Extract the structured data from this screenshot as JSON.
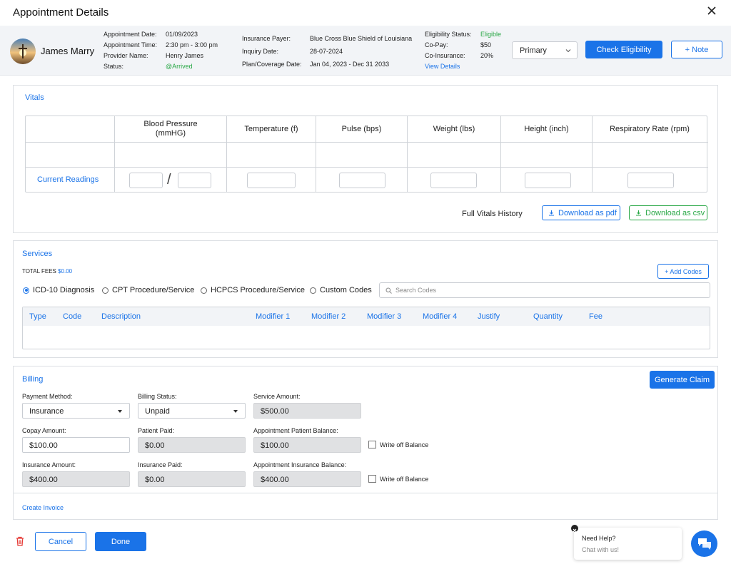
{
  "header": {
    "title": "Appointment Details"
  },
  "patient": {
    "name": "James Marry",
    "appointment_date_label": "Appointment Date:",
    "appointment_date": "01/09/2023",
    "appointment_time_label": "Appointment Time:",
    "appointment_time": "2:30 pm - 3:00 pm",
    "provider_label": "Provider Name:",
    "provider": "Henry James",
    "status_label": "Status:",
    "status": "@Arrived"
  },
  "insurance": {
    "payer_label": "Insurance Payer:",
    "payer": "Blue Cross Blue Shield of Louisiana",
    "inquiry_label": "Inquiry Date:",
    "inquiry": "28-07-2024",
    "plan_label": "Plan/Coverage Date:",
    "plan": "Jan 04, 2023 - Dec 31 2033"
  },
  "eligibility": {
    "status_label": "Eligibility Status:",
    "status": "Eligible",
    "copay_label": "Co-Pay:",
    "copay": "$50",
    "coins_label": "Co-Insurance:",
    "coins": "20%",
    "view_details": "View Details"
  },
  "actions": {
    "primary_select": "Primary",
    "check_eligibility": "Check Eligibility",
    "note": "+ Note"
  },
  "vitals": {
    "title": "Vitals",
    "columns": [
      "Blood Pressure",
      "(mmHG)",
      "Temperature (f)",
      "Pulse (bps)",
      "Weight (lbs)",
      "Height (inch)",
      "Respiratory Rate (rpm)"
    ],
    "current_readings": "Current Readings",
    "slash": "/",
    "full_history": "Full Vitals History",
    "download_pdf": "Download as pdf",
    "download_csv": "Download as csv"
  },
  "services": {
    "title": "Services",
    "total_fees_label": "TOTAL FEES",
    "total_fees": "$0.00",
    "add_codes": "+ Add Codes",
    "radios": [
      "ICD-10 Diagnosis",
      "CPT Procedure/Service",
      "HCPCS Procedure/Service",
      "Custom Codes"
    ],
    "selected_radio": "ICD-10 Diagnosis",
    "search_placeholder": "Search Codes",
    "columns": [
      "Type",
      "Code",
      "Description",
      "Modifier 1",
      "Modifier 2",
      "Modifier 3",
      "Modifier 4",
      "Justify",
      "Quantity",
      "Fee"
    ]
  },
  "billing": {
    "title": "Billing",
    "generate_claim": "Generate Claim",
    "payment_method_label": "Payment Method:",
    "payment_method": "Insurance",
    "billing_status_label": "Billing Status:",
    "billing_status": "Unpaid",
    "service_amount_label": "Service Amount:",
    "service_amount": "$500.00",
    "copay_amount_label": "Copay Amount:",
    "copay_amount": "$100.00",
    "patient_paid_label": "Patient Paid:",
    "patient_paid": "$0.00",
    "appt_patient_balance_label": "Appointment Patient Balance:",
    "appt_patient_balance": "$100.00",
    "write_off_1": "Write off Balance",
    "insurance_amount_label": "Insurance Amount:",
    "insurance_amount": "$400.00",
    "insurance_paid_label": "Insurance Paid:",
    "insurance_paid": "$0.00",
    "appt_insurance_balance_label": "Appointment Insurance Balance:",
    "appt_insurance_balance": "$400.00",
    "write_off_2": "Write off Balance",
    "create_invoice": "Create Invoice"
  },
  "footer": {
    "cancel": "Cancel",
    "done": "Done"
  },
  "help": {
    "title": "Need Help?",
    "subtitle": "Chat with us!"
  },
  "colors": {
    "accent": "#1a73e8",
    "success": "#28a745",
    "danger": "#e53935"
  }
}
